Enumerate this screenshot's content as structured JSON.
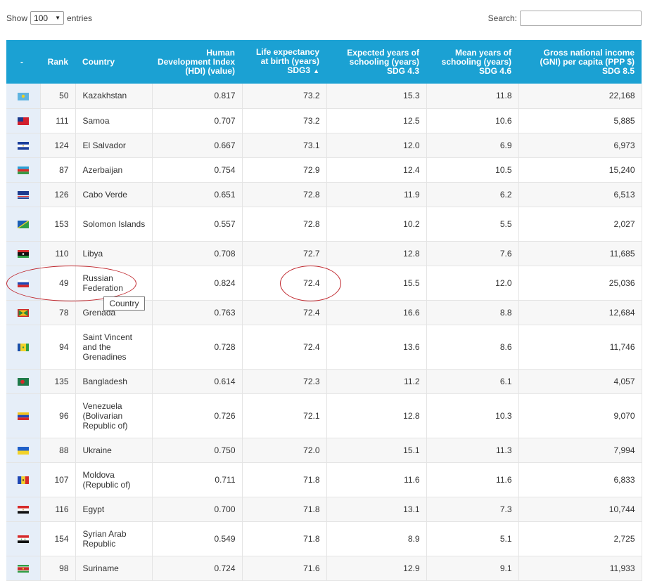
{
  "controls": {
    "show_label": "Show",
    "entries_value": "100",
    "entries_label": "entries",
    "search_label": "Search:",
    "search_value": ""
  },
  "columns": [
    {
      "key": "flag",
      "label": "-"
    },
    {
      "key": "rank",
      "label": "Rank"
    },
    {
      "key": "country",
      "label": "Country"
    },
    {
      "key": "hdi",
      "label": "Human Development Index (HDI) (value)"
    },
    {
      "key": "life",
      "label": "Life expectancy at birth (years) SDG3",
      "sort_indicator": "▲"
    },
    {
      "key": "expected",
      "label": "Expected years of schooling (years) SDG 4.3"
    },
    {
      "key": "mean",
      "label": "Mean years of schooling (years) SDG 4.6"
    },
    {
      "key": "gni",
      "label": "Gross national income (GNI) per capita (PPP $) SDG 8.5"
    }
  ],
  "rows": [
    {
      "flag": "kazakhstan-flag-icon",
      "rank": "50",
      "country": "Kazakhstan",
      "hdi": "0.817",
      "life": "73.2",
      "expected": "15.3",
      "mean": "11.8",
      "gni": "22,168"
    },
    {
      "flag": "samoa-flag-icon",
      "rank": "111",
      "country": "Samoa",
      "hdi": "0.707",
      "life": "73.2",
      "expected": "12.5",
      "mean": "10.6",
      "gni": "5,885"
    },
    {
      "flag": "el-salvador-flag-icon",
      "rank": "124",
      "country": "El Salvador",
      "hdi": "0.667",
      "life": "73.1",
      "expected": "12.0",
      "mean": "6.9",
      "gni": "6,973"
    },
    {
      "flag": "azerbaijan-flag-icon",
      "rank": "87",
      "country": "Azerbaijan",
      "hdi": "0.754",
      "life": "72.9",
      "expected": "12.4",
      "mean": "10.5",
      "gni": "15,240"
    },
    {
      "flag": "cabo-verde-flag-icon",
      "rank": "126",
      "country": "Cabo Verde",
      "hdi": "0.651",
      "life": "72.8",
      "expected": "11.9",
      "mean": "6.2",
      "gni": "6,513"
    },
    {
      "flag": "solomon-islands-flag-icon",
      "rank": "153",
      "country": "Solomon Islands",
      "hdi": "0.557",
      "life": "72.8",
      "expected": "10.2",
      "mean": "5.5",
      "gni": "2,027"
    },
    {
      "flag": "libya-flag-icon",
      "rank": "110",
      "country": "Libya",
      "hdi": "0.708",
      "life": "72.7",
      "expected": "12.8",
      "mean": "7.6",
      "gni": "11,685"
    },
    {
      "flag": "russia-flag-icon",
      "rank": "49",
      "country": "Russian Federation",
      "hdi": "0.824",
      "life": "72.4",
      "expected": "15.5",
      "mean": "12.0",
      "gni": "25,036"
    },
    {
      "flag": "grenada-flag-icon",
      "rank": "78",
      "country": "Grenada",
      "hdi": "0.763",
      "life": "72.4",
      "expected": "16.6",
      "mean": "8.8",
      "gni": "12,684"
    },
    {
      "flag": "saint-vincent-flag-icon",
      "rank": "94",
      "country": "Saint Vincent and the Grenadines",
      "hdi": "0.728",
      "life": "72.4",
      "expected": "13.6",
      "mean": "8.6",
      "gni": "11,746"
    },
    {
      "flag": "bangladesh-flag-icon",
      "rank": "135",
      "country": "Bangladesh",
      "hdi": "0.614",
      "life": "72.3",
      "expected": "11.2",
      "mean": "6.1",
      "gni": "4,057"
    },
    {
      "flag": "venezuela-flag-icon",
      "rank": "96",
      "country": "Venezuela (Bolivarian Republic of)",
      "hdi": "0.726",
      "life": "72.1",
      "expected": "12.8",
      "mean": "10.3",
      "gni": "9,070"
    },
    {
      "flag": "ukraine-flag-icon",
      "rank": "88",
      "country": "Ukraine",
      "hdi": "0.750",
      "life": "72.0",
      "expected": "15.1",
      "mean": "11.3",
      "gni": "7,994"
    },
    {
      "flag": "moldova-flag-icon",
      "rank": "107",
      "country": "Moldova (Republic of)",
      "hdi": "0.711",
      "life": "71.8",
      "expected": "11.6",
      "mean": "11.6",
      "gni": "6,833"
    },
    {
      "flag": "egypt-flag-icon",
      "rank": "116",
      "country": "Egypt",
      "hdi": "0.700",
      "life": "71.8",
      "expected": "13.1",
      "mean": "7.3",
      "gni": "10,744"
    },
    {
      "flag": "syria-flag-icon",
      "rank": "154",
      "country": "Syrian Arab Republic",
      "hdi": "0.549",
      "life": "71.8",
      "expected": "8.9",
      "mean": "5.1",
      "gni": "2,725"
    },
    {
      "flag": "suriname-flag-icon",
      "rank": "98",
      "country": "Suriname",
      "hdi": "0.724",
      "life": "71.6",
      "expected": "12.9",
      "mean": "9.1",
      "gni": "11,933"
    }
  ],
  "tooltip": {
    "text": "Country"
  },
  "colors": {
    "header": "#1ba1d3",
    "annotation": "#c0282e"
  }
}
